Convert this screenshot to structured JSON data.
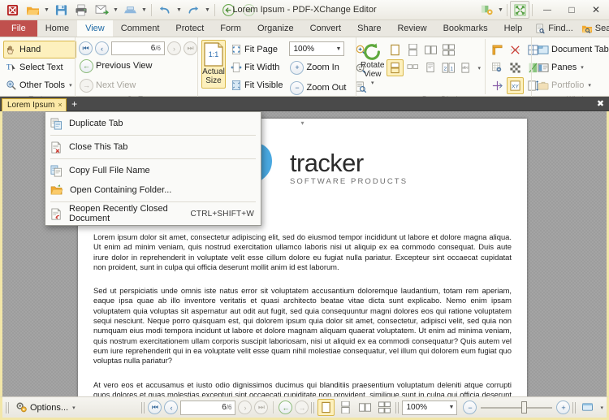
{
  "window": {
    "title": "Lorem Ipsum - PDF-XChange Editor",
    "quick_access": [
      {
        "name": "app-logo",
        "glyph": "logo"
      },
      {
        "name": "open-file-button",
        "glyph": "folder"
      },
      {
        "name": "save-file-button",
        "glyph": "save"
      },
      {
        "name": "print-button",
        "glyph": "printer"
      },
      {
        "name": "email-button",
        "glyph": "email"
      },
      {
        "name": "scan-button",
        "glyph": "scanner"
      },
      {
        "name": "undo-button",
        "glyph": "undo"
      },
      {
        "name": "redo-button",
        "glyph": "redo"
      },
      {
        "name": "back-button",
        "glyph": "back"
      },
      {
        "name": "forward-button",
        "glyph": "forward"
      }
    ],
    "customize_label": "customize-quick-access",
    "fullscreen_label": "fullscreen-toggle",
    "minimize": "—",
    "maximize": "□",
    "close": "✕"
  },
  "ribbon": {
    "tabs": [
      {
        "label": "File",
        "state": "file"
      },
      {
        "label": "Home",
        "state": "normal"
      },
      {
        "label": "View",
        "state": "active"
      },
      {
        "label": "Comment",
        "state": "normal"
      },
      {
        "label": "Protect",
        "state": "normal"
      },
      {
        "label": "Form",
        "state": "normal"
      },
      {
        "label": "Organize",
        "state": "normal"
      },
      {
        "label": "Convert",
        "state": "normal"
      },
      {
        "label": "Share",
        "state": "normal"
      },
      {
        "label": "Review",
        "state": "normal"
      },
      {
        "label": "Bookmarks",
        "state": "normal"
      },
      {
        "label": "Help",
        "state": "normal"
      }
    ],
    "find_label": "Find...",
    "search_label": "Search...",
    "collapse_ribbon": "⌃",
    "groups": {
      "tools": {
        "label": "Tools",
        "hand": "Hand",
        "select_text": "Select Text",
        "other_tools": "Other Tools"
      },
      "goto": {
        "label": "Go To",
        "page_value": "6",
        "page_total": "/6",
        "previous_view": "Previous View",
        "next_view": "Next View"
      },
      "zoom": {
        "label": "Zoom",
        "actual_size": "Actual Size",
        "actual_size_badge": "1:1",
        "fit_page": "Fit Page",
        "fit_width": "Fit Width",
        "fit_visible": "Fit Visible",
        "zoom_value": "100%",
        "zoom_in": "Zoom In",
        "zoom_out": "Zoom Out"
      },
      "page_display": {
        "label": "Page Display",
        "rotate_view": "Rotate View"
      },
      "window": {
        "label": "Window",
        "document_tabs": "Document Tabs",
        "panes": "Panes",
        "portfolio": "Portfolio"
      }
    }
  },
  "document_tabs": {
    "tabs": [
      {
        "label": "Lorem Ipsum",
        "close": "×"
      }
    ],
    "new_tab": "+",
    "close_all": "✖"
  },
  "context_menu": {
    "items": [
      {
        "label": "Duplicate Tab",
        "icon": "duplicate-tab-icon",
        "accel": "",
        "sep_after": true
      },
      {
        "label": "Close This Tab",
        "icon": "close-tab-icon",
        "accel": "",
        "sep_after": true
      },
      {
        "label": "Copy Full File Name",
        "icon": "copy-file-name-icon",
        "accel": "",
        "sep_after": false
      },
      {
        "label": "Open Containing Folder...",
        "icon": "open-folder-icon",
        "accel": "",
        "sep_after": true
      },
      {
        "label": "Reopen Recently Closed Document",
        "icon": "reopen-document-icon",
        "accel": "CTRL+SHIFT+W",
        "sep_after": false
      }
    ]
  },
  "document": {
    "logo_name": "tracker",
    "logo_tagline": "SOFTWARE PRODUCTS",
    "paragraphs": [
      "Lorem ipsum dolor sit amet, consectetur adipiscing elit, sed do eiusmod tempor incididunt ut labore et dolore magna aliqua. Ut enim ad minim veniam, quis nostrud exercitation ullamco laboris nisi ut aliquip ex ea commodo consequat. Duis aute irure dolor in reprehenderit in voluptate velit esse cillum dolore eu fugiat nulla pariatur. Excepteur sint occaecat cupidatat non proident, sunt in culpa qui officia deserunt mollit anim id est laborum.",
      "Sed ut perspiciatis unde omnis iste natus error sit voluptatem accusantium doloremque laudantium, totam rem aperiam, eaque ipsa quae ab illo inventore veritatis et quasi architecto beatae vitae dicta sunt explicabo. Nemo enim ipsam voluptatem quia voluptas sit aspernatur aut odit aut fugit, sed quia consequuntur magni dolores eos qui ratione voluptatem sequi nesciunt. Neque porro quisquam est, qui dolorem ipsum quia dolor sit amet, consectetur, adipisci velit, sed quia non numquam eius modi tempora incidunt ut labore et dolore magnam aliquam quaerat voluptatem. Ut enim ad minima veniam, quis nostrum exercitationem ullam corporis suscipit laboriosam, nisi ut aliquid ex ea commodi consequatur? Quis autem vel eum iure reprehenderit qui in ea voluptate velit esse quam nihil molestiae consequatur, vel illum qui dolorem eum fugiat quo voluptas nulla pariatur?",
      "At vero eos et accusamus et iusto odio dignissimos ducimus qui blanditiis praesentium voluptatum deleniti atque corrupti quos dolores et quas molestias excepturi sint occaecati cupiditate non provident, similique sunt in culpa qui officia deserunt mollitia animi, id est laborum et dolorum fuga."
    ]
  },
  "status_bar": {
    "options": "Options...",
    "page_value": "6",
    "page_total": "/6",
    "zoom_value": "100%"
  },
  "colors": {
    "file_tab": "#c0504d",
    "active_tab_text": "#1f6aa5",
    "highlight": "#fdf0bd",
    "tab_bar": "#4a4a4a",
    "doc_tab": "#fbe8a6",
    "viewport": "#9d9d9d",
    "frame": "#f2e6a8"
  }
}
